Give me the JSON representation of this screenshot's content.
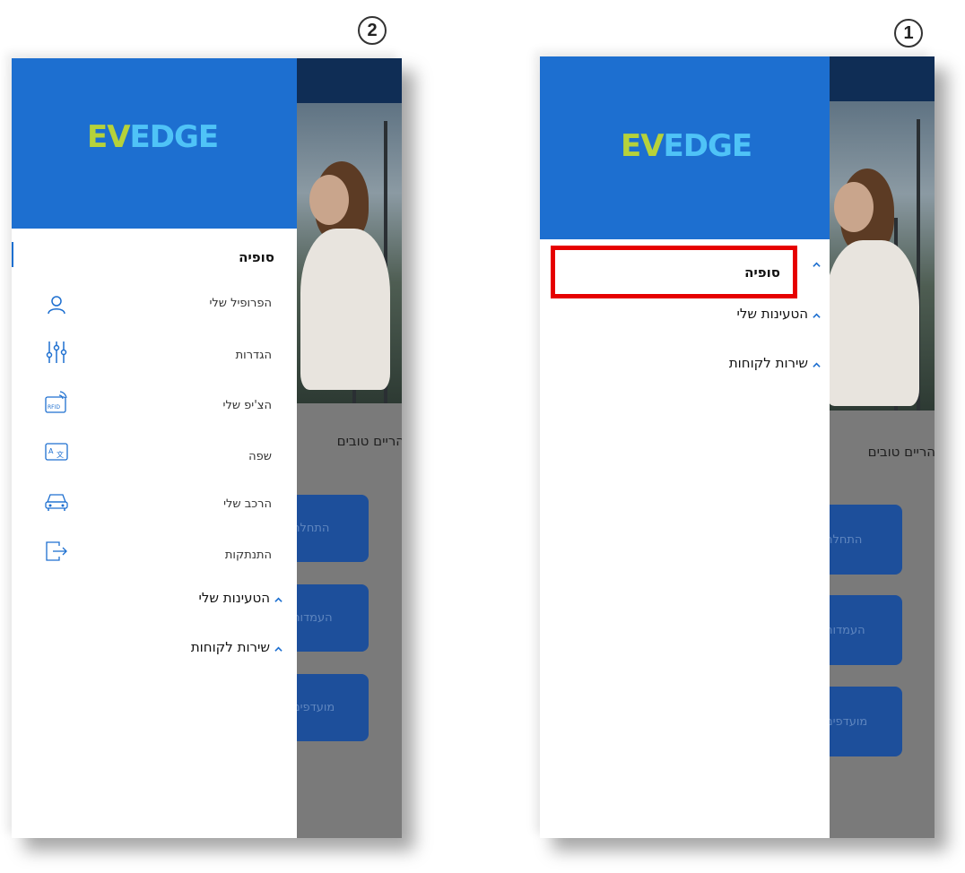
{
  "badges": {
    "left": "2",
    "right": "1"
  },
  "logo": {
    "part1": "EV",
    "part2": "EDGE"
  },
  "background": {
    "greeting": "צהריים טובים",
    "buttons": [
      "התחלה",
      "העמדות",
      "מועדפים"
    ]
  },
  "screen_expanded": {
    "user_name": "סופיה",
    "menu": [
      {
        "label": "הפרופיל שלי",
        "icon": "user-icon"
      },
      {
        "label": "הגדרות",
        "icon": "sliders-icon"
      },
      {
        "label": "הצ'יפ שלי",
        "icon": "rfid-card-icon"
      },
      {
        "label": "שפה",
        "icon": "translate-icon"
      },
      {
        "label": "הרכב שלי",
        "icon": "car-icon"
      },
      {
        "label": "התנתקות",
        "icon": "logout-icon"
      }
    ],
    "sections": [
      "הטעינות שלי",
      "שירות לקוחות"
    ]
  },
  "screen_collapsed": {
    "user_name": "סופיה",
    "sections": [
      "הטעינות שלי",
      "שירות לקוחות"
    ]
  },
  "colors": {
    "drawer_header": "#1d6fd0",
    "highlight": "#e60000",
    "accent": "#1d6fd0"
  }
}
